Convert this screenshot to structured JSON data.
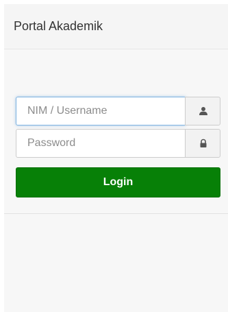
{
  "panel": {
    "title": "Portal Akademik"
  },
  "login_form": {
    "username": {
      "placeholder": "NIM / Username",
      "value": "",
      "icon": "user-icon"
    },
    "password": {
      "placeholder": "Password",
      "value": "",
      "icon": "lock-icon"
    },
    "login_label": "Login"
  },
  "colors": {
    "login_button": "#078007",
    "focus_border": "#7fb3e0",
    "addon_background": "#f2f2f2",
    "panel_background": "#f7f7f7"
  }
}
